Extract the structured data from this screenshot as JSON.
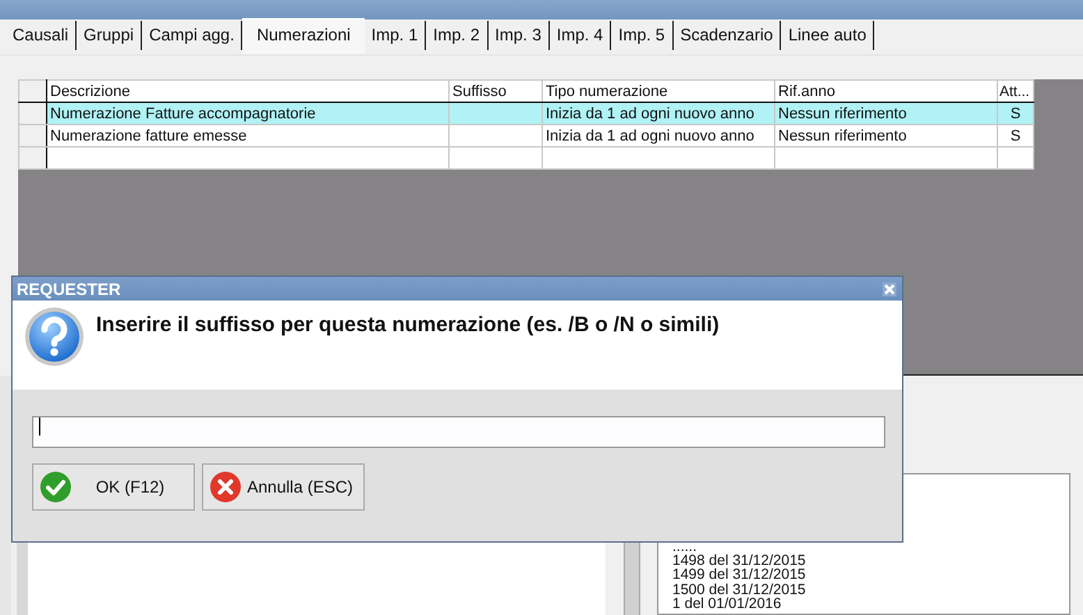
{
  "tabs": [
    {
      "label": "Causali",
      "selected": false
    },
    {
      "label": "Gruppi",
      "selected": false
    },
    {
      "label": "Campi agg.",
      "selected": false
    },
    {
      "label": "Numerazioni",
      "selected": true
    },
    {
      "label": "Imp. 1",
      "selected": false
    },
    {
      "label": "Imp. 2",
      "selected": false
    },
    {
      "label": "Imp. 3",
      "selected": false
    },
    {
      "label": "Imp. 4",
      "selected": false
    },
    {
      "label": "Imp. 5",
      "selected": false
    },
    {
      "label": "Scadenzario",
      "selected": false
    },
    {
      "label": "Linee auto",
      "selected": false
    }
  ],
  "grid": {
    "columns": [
      "Descrizione",
      "Suffisso",
      "Tipo numerazione",
      "Rif.anno",
      "Att..."
    ],
    "rows": [
      {
        "cells": [
          "Numerazione Fatture accompagnatorie",
          "",
          "Inizia da 1 ad ogni nuovo anno",
          "Nessun riferimento",
          "S"
        ],
        "selected": true
      },
      {
        "cells": [
          "Numerazione fatture emesse",
          "",
          "Inizia da 1 ad ogni nuovo anno",
          "Nessun riferimento",
          "S"
        ],
        "selected": false
      }
    ]
  },
  "list": {
    "items": [
      "......",
      "1498 del 31/12/2015",
      "1499 del 31/12/2015",
      "1500 del 31/12/2015",
      "1 del 01/01/2016"
    ]
  },
  "dialog": {
    "title": "REQUESTER",
    "message": "Inserire il suffisso per questa numerazione (es. /B o /N o simili)",
    "buttons": [
      {
        "label": "OK (F12)",
        "kind": "ok"
      },
      {
        "label": "Annulla (ESC)",
        "kind": "cancel"
      }
    ]
  }
}
